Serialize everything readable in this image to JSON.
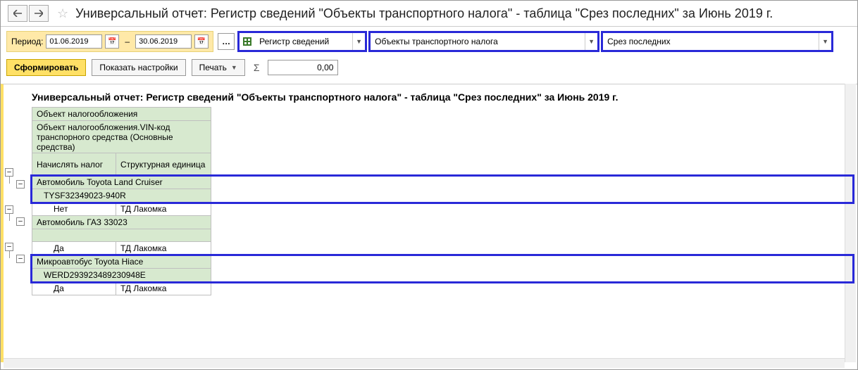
{
  "title": "Универсальный отчет: Регистр сведений \"Объекты транспортного налога\" - таблица \"Срез последних\" за Июнь 2019 г.",
  "toolbar": {
    "period_label": "Период:",
    "date_from": "01.06.2019",
    "date_to": "30.06.2019",
    "dash": "–",
    "combo1": "Регистр сведений",
    "combo2": "Объекты транспортного налога",
    "combo3": "Срез последних",
    "generate": "Сформировать",
    "show_settings": "Показать настройки",
    "print": "Печать",
    "sum": "0,00"
  },
  "report": {
    "title": "Универсальный отчет: Регистр сведений \"Объекты транспортного налога\" - таблица \"Срез последних\" за Июнь 2019 г.",
    "headers": {
      "h1": "Объект налогообложения",
      "h2": "Объект налогообложения.VIN-код транспорного средства (Основные средства)",
      "h3": "Начислять налог",
      "h4": "Структурная единица"
    },
    "groups": [
      {
        "object": "Автомобиль Toyota Land Cruiser",
        "vin": "TYSF32349023-940R",
        "rows": [
          {
            "tax": "Нет",
            "unit": "ТД Лакомка"
          }
        ],
        "highlighted": true
      },
      {
        "object": "Автомобиль ГАЗ 33023",
        "vin": "",
        "rows": [
          {
            "tax": "Да",
            "unit": "ТД Лакомка"
          }
        ],
        "highlighted": false
      },
      {
        "object": "Микроавтобус Toyota Hiace",
        "vin": "WERD293923489230948E",
        "rows": [
          {
            "tax": "Да",
            "unit": "ТД Лакомка"
          }
        ],
        "highlighted": true
      }
    ]
  }
}
